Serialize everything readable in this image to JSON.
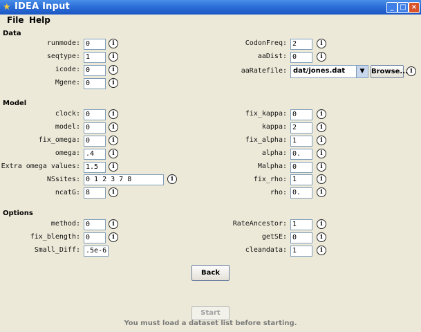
{
  "window": {
    "title": "IDEA Input",
    "app_icon": "star-icon",
    "minimize": "_",
    "maximize": "□",
    "close": "×"
  },
  "menu": {
    "file": "File",
    "help": "Help"
  },
  "sections": {
    "data": "Data",
    "model": "Model",
    "options": "Options"
  },
  "info_glyph": "i",
  "data_left": [
    {
      "label": "runmode:",
      "value": "0"
    },
    {
      "label": "seqtype:",
      "value": "1"
    },
    {
      "label": "icode:",
      "value": "0"
    },
    {
      "label": "Mgene:",
      "value": "0"
    }
  ],
  "data_right": [
    {
      "label": "CodonFreq:",
      "value": "2"
    },
    {
      "label": "aaDist:",
      "value": "0"
    },
    {
      "label": "aaRatefile:",
      "value": "dat/jones.dat"
    }
  ],
  "browse_label": "Browse...",
  "model_left": [
    {
      "label": "clock:",
      "value": "0"
    },
    {
      "label": "model:",
      "value": "0"
    },
    {
      "label": "fix_omega:",
      "value": "0"
    },
    {
      "label": "omega:",
      "value": ".4"
    },
    {
      "label": "Extra omega values:",
      "value": "1.5"
    },
    {
      "label": "NSsites:",
      "value": "0 1 2 3 7 8"
    },
    {
      "label": "ncatG:",
      "value": "8"
    }
  ],
  "model_right": [
    {
      "label": "fix_kappa:",
      "value": "0"
    },
    {
      "label": "kappa:",
      "value": "2"
    },
    {
      "label": "fix_alpha:",
      "value": "1"
    },
    {
      "label": "alpha:",
      "value": "0."
    },
    {
      "label": "Malpha:",
      "value": "0"
    },
    {
      "label": "fix_rho:",
      "value": "1"
    },
    {
      "label": "rho:",
      "value": "0."
    }
  ],
  "options_left": [
    {
      "label": "method:",
      "value": "0"
    },
    {
      "label": "fix_blength:",
      "value": "0"
    },
    {
      "label": "Small_Diff:",
      "value": ".5e-6"
    }
  ],
  "options_right": [
    {
      "label": "RateAncestor:",
      "value": "1"
    },
    {
      "label": "getSE:",
      "value": "0"
    },
    {
      "label": "cleandata:",
      "value": "1"
    }
  ],
  "back_label": "Back",
  "start_label": "Start",
  "status_text": "You must load a dataset list before starting."
}
